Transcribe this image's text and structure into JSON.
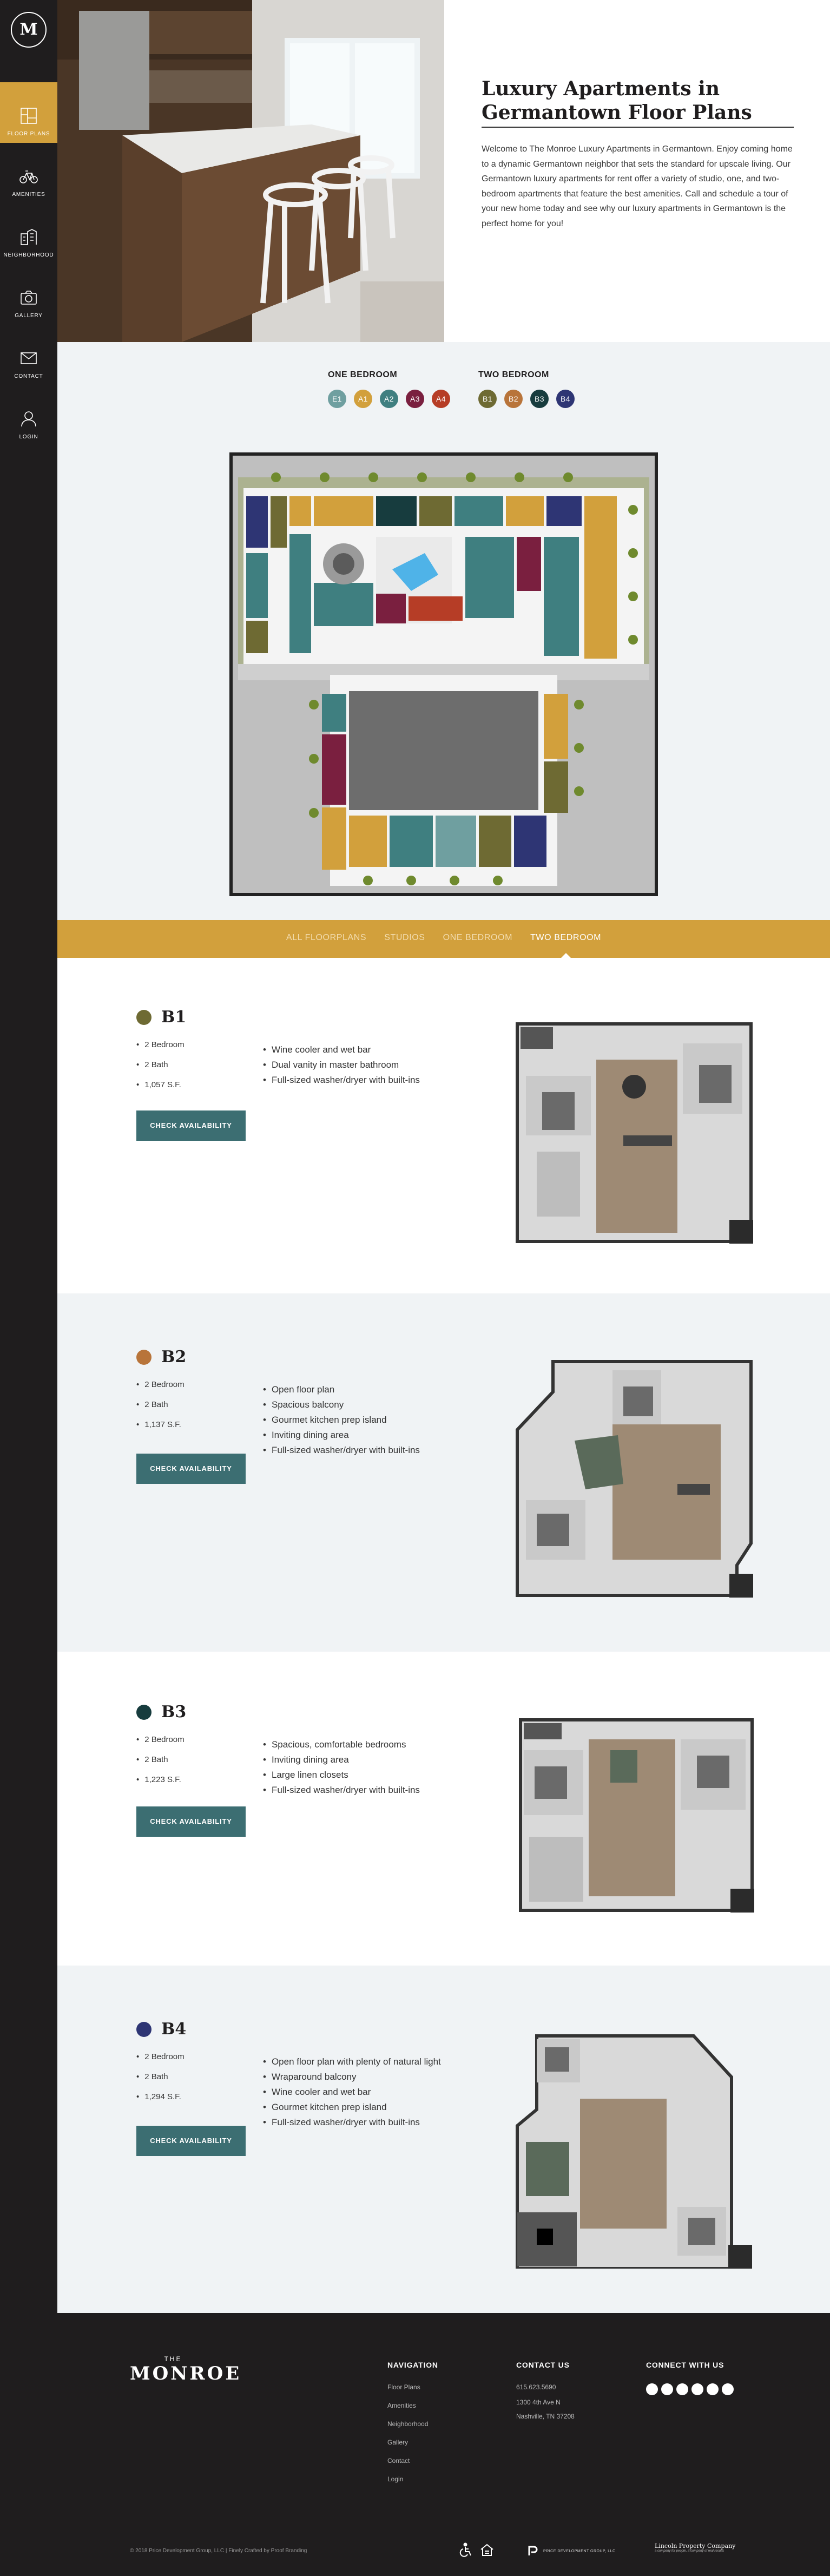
{
  "sidebar": {
    "logo_letter": "M",
    "items": [
      {
        "label": "Floor Plans",
        "icon": "floorplan-icon"
      },
      {
        "label": "Amenities",
        "icon": "bicycle-icon"
      },
      {
        "label": "Neighborhood",
        "icon": "buildings-icon"
      },
      {
        "label": "Gallery",
        "icon": "camera-icon"
      },
      {
        "label": "Contact",
        "icon": "envelope-icon"
      },
      {
        "label": "Login",
        "icon": "user-icon"
      }
    ]
  },
  "hero": {
    "title": "Luxury Apartments in Germantown Floor Plans",
    "body": "Welcome to The Monroe Luxury Apartments in Germantown. Enjoy coming home to a dynamic Germantown neighbor that sets the standard for upscale living. Our Germantown luxury apartments for rent offer a variety of studio, one, and two-bedroom apartments that feature the best amenities. Call and schedule a tour of your new home today and see why our luxury apartments in Germantown is the perfect home for you!"
  },
  "legend": {
    "one_bedroom": {
      "title": "ONE BEDROOM",
      "chips": [
        {
          "label": "E1",
          "color": "#6f9fa0"
        },
        {
          "label": "A1",
          "color": "#d2a03c"
        },
        {
          "label": "A2",
          "color": "#3f7f80"
        },
        {
          "label": "A3",
          "color": "#7a1f3f"
        },
        {
          "label": "A4",
          "color": "#b63d26"
        }
      ]
    },
    "two_bedroom": {
      "title": "TWO BEDROOM",
      "chips": [
        {
          "label": "B1",
          "color": "#6e6a33"
        },
        {
          "label": "B2",
          "color": "#b8743a"
        },
        {
          "label": "B3",
          "color": "#173c3e"
        },
        {
          "label": "B4",
          "color": "#2e3574"
        }
      ]
    }
  },
  "filters": [
    "ALL FLOORPLANS",
    "STUDIOS",
    "ONE BEDROOM",
    "TWO BEDROOM"
  ],
  "units": [
    {
      "name": "B1",
      "color": "#6e6a33",
      "specs": [
        "2 Bedroom",
        "2 Bath",
        "1,057 S.F."
      ],
      "features": [
        "Wine cooler and wet bar",
        "Dual vanity in master bathroom",
        "Full-sized washer/dryer with built-ins"
      ],
      "cta": "CHECK AVAILABILITY"
    },
    {
      "name": "B2",
      "color": "#b8743a",
      "specs": [
        "2 Bedroom",
        "2 Bath",
        "1,137 S.F."
      ],
      "features": [
        "Open floor plan",
        "Spacious balcony",
        "Gourmet kitchen prep island",
        "Inviting dining area",
        "Full-sized washer/dryer with built-ins"
      ],
      "cta": "CHECK AVAILABILITY"
    },
    {
      "name": "B3",
      "color": "#173c3e",
      "specs": [
        "2 Bedroom",
        "2 Bath",
        "1,223 S.F."
      ],
      "features": [
        "Spacious, comfortable bedrooms",
        "Inviting dining area",
        "Large linen closets",
        "Full-sized washer/dryer with built-ins"
      ],
      "cta": "CHECK AVAILABILITY"
    },
    {
      "name": "B4",
      "color": "#2e3574",
      "specs": [
        "2 Bedroom",
        "2 Bath",
        "1,294 S.F."
      ],
      "features": [
        "Open floor plan with plenty of natural light",
        "Wraparound balcony",
        "Wine cooler and wet bar",
        "Gourmet kitchen prep island",
        "Full-sized washer/dryer with built-ins"
      ],
      "cta": "CHECK AVAILABILITY"
    }
  ],
  "footer": {
    "brand_small": "THE",
    "brand": "MONROE",
    "nav_title": "NAVIGATION",
    "nav_links": [
      "Floor Plans",
      "Amenities",
      "Neighborhood",
      "Gallery",
      "Contact",
      "Login"
    ],
    "contact_title": "CONTACT US",
    "phone": "615.623.5690",
    "address1": "1300 4th Ave N",
    "address2": "Nashville, TN 37208",
    "connect_title": "CONNECT WITH US",
    "social": [
      "facebook-icon",
      "twitter-icon",
      "instagram-icon",
      "youtube-icon",
      "googleplus-icon",
      "pinterest-icon"
    ],
    "copyright": "© 2018 Price Development Group, LLC | Finely Crafted by Proof Branding",
    "partner1": "PRICE DEVELOPMENT GROUP, LLC",
    "partner2": "Lincoln Property Company",
    "partner2_sub": "a company for people, a company of real results"
  }
}
